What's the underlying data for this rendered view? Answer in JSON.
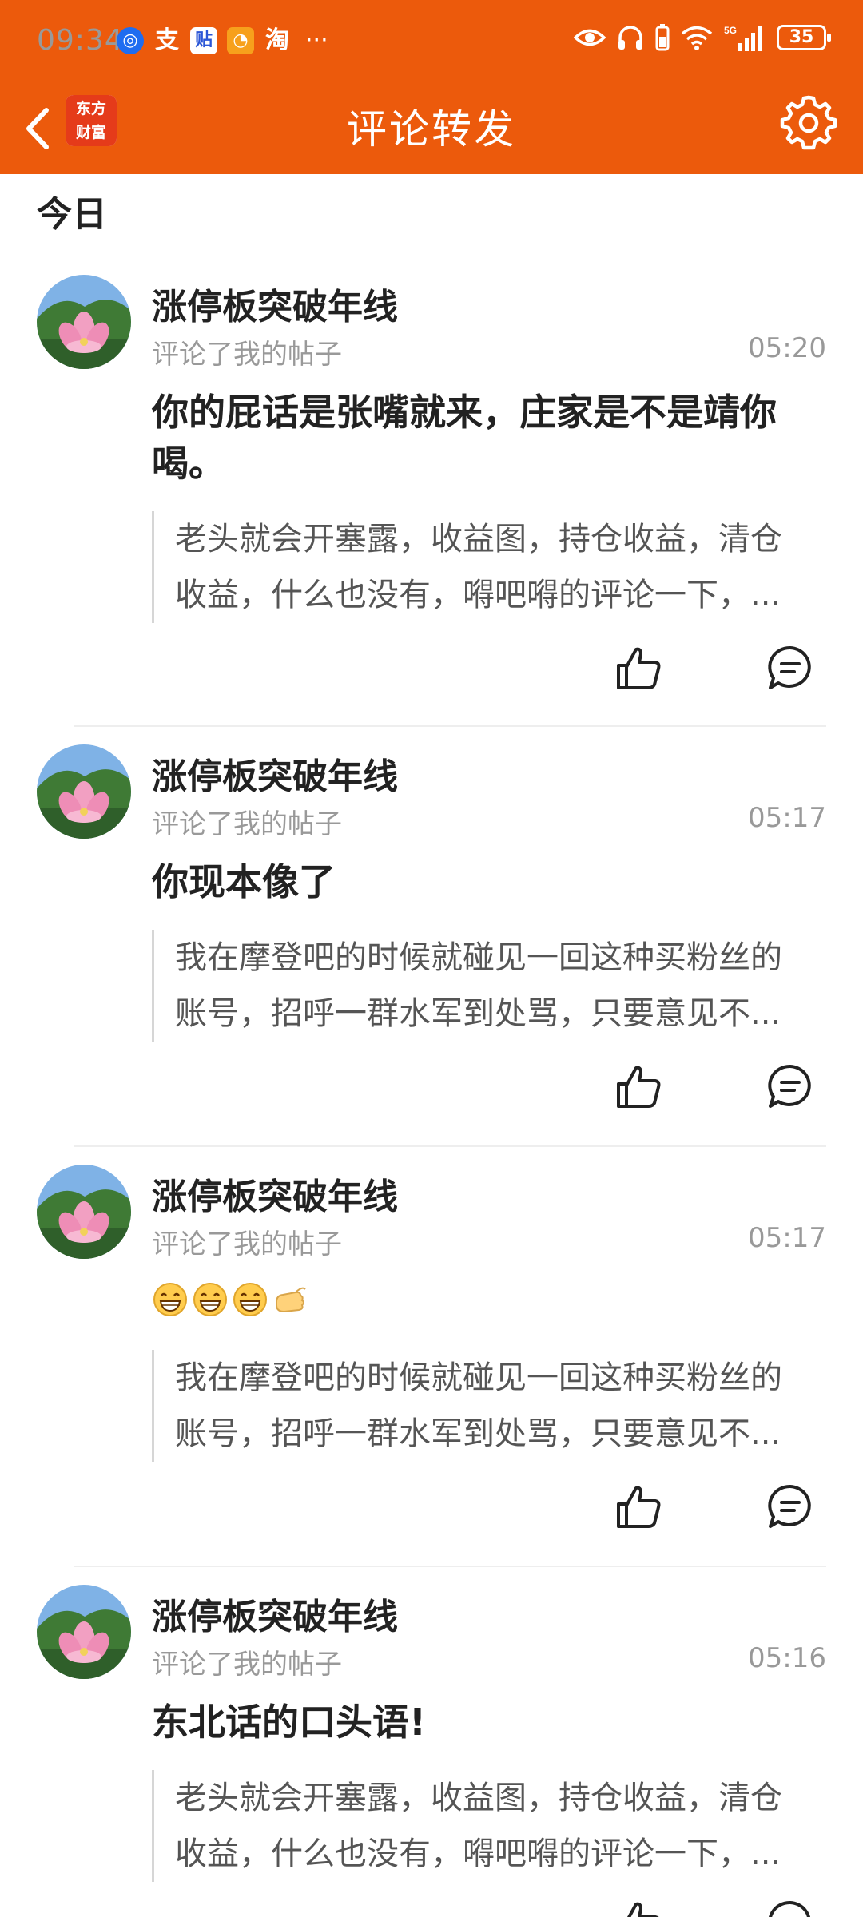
{
  "status_bar": {
    "time": "09:34",
    "more": "···",
    "battery": "35",
    "network": "5G"
  },
  "header": {
    "title": "评论转发",
    "logo_text_line1": "东方",
    "logo_text_line2": "财富"
  },
  "section": {
    "title": "今日"
  },
  "comments": [
    {
      "user": "涨停板突破年线",
      "action": "评论了我的帖子",
      "time": "05:20",
      "text": "你的屁话是张嘴就来，庄家是不是靖你喝。",
      "quote_line1": "老头就会开塞露，收益图，持仓收益，清仓",
      "quote_line2": "收益，什么也没有，嘚吧嘚的评论一下，..."
    },
    {
      "user": "涨停板突破年线",
      "action": "评论了我的帖子",
      "time": "05:17",
      "text": "你现本像了",
      "quote_line1": "我在摩登吧的时候就碰见一回这种买粉丝的",
      "quote_line2": "账号，招呼一群水军到处骂，只要意见不..."
    },
    {
      "user": "涨停板突破年线",
      "action": "评论了我的帖子",
      "time": "05:17",
      "emojis": [
        "grin-emoji",
        "grin-emoji",
        "grin-emoji",
        "thumbs-hand-emoji"
      ],
      "quote_line1": "我在摩登吧的时候就碰见一回这种买粉丝的",
      "quote_line2": "账号，招呼一群水军到处骂，只要意见不..."
    },
    {
      "user": "涨停板突破年线",
      "action": "评论了我的帖子",
      "time": "05:16",
      "text": "东北话的口头语!",
      "quote_line1": "老头就会开塞露，收益图，持仓收益，清仓",
      "quote_line2": "收益，什么也没有，嘚吧嘚的评论一下，..."
    }
  ],
  "colors": {
    "brand": "#ec5a0c",
    "meta_text": "#999999",
    "divider": "#eeeeee"
  }
}
